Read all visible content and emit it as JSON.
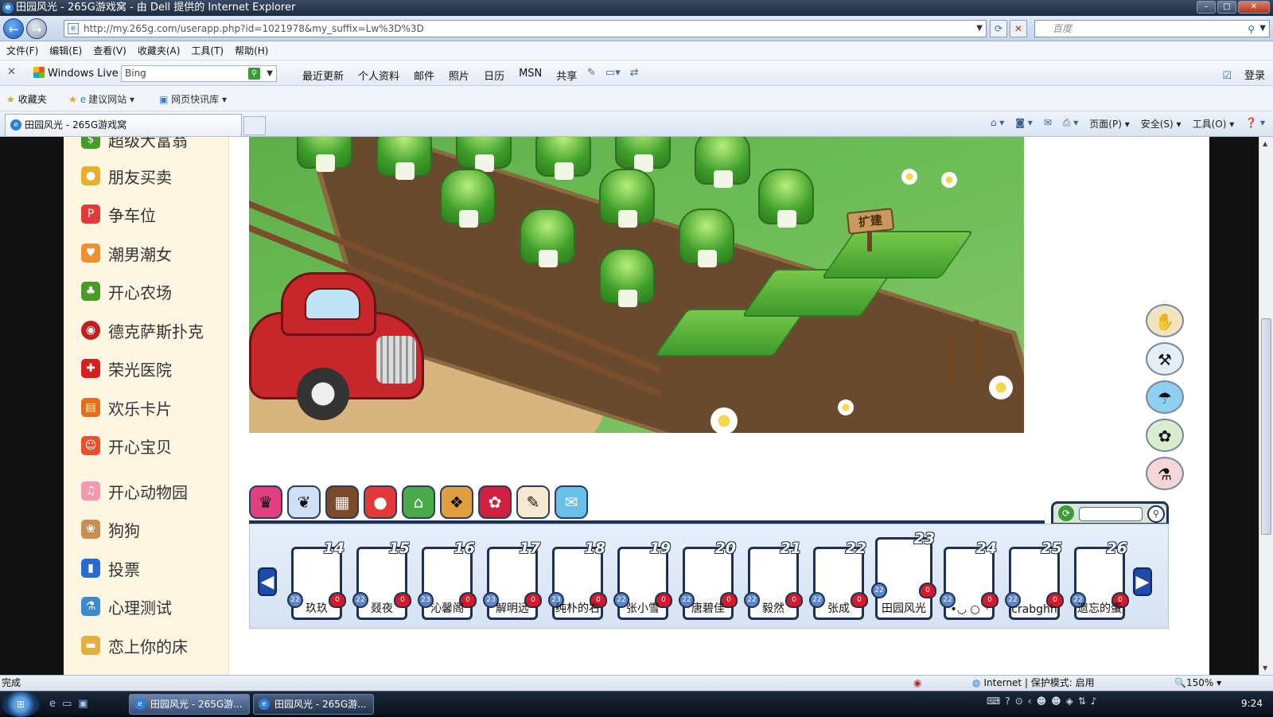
{
  "window": {
    "title": "田园风光 - 265G游戏窝 - 由 Dell 提供的 Internet Explorer"
  },
  "address": {
    "url": "http://my.265g.com/userapp.php?id=1021978&my_suffix=Lw%3D%3D"
  },
  "search": {
    "placeholder": "百度"
  },
  "menu": [
    "文件(F)",
    "编辑(E)",
    "查看(V)",
    "收藏夹(A)",
    "工具(T)",
    "帮助(H)"
  ],
  "live": {
    "brand": "Windows Live",
    "search_value": "Bing",
    "links": [
      "最近更新",
      "个人资料",
      "邮件",
      "照片",
      "日历",
      "MSN",
      "共享"
    ],
    "login": "登录"
  },
  "favorites": {
    "label": "收藏夹",
    "suggested": "建议网站",
    "webslice": "网页快讯库"
  },
  "tab": {
    "title": "田园风光 - 265G游戏窝"
  },
  "commands": {
    "page": "页面(P)",
    "safety": "安全(S)",
    "tools": "工具(O)"
  },
  "sidebar": {
    "top_partial": "超级大富翁",
    "items": [
      {
        "label": "朋友买卖",
        "icon": "coins-icon",
        "color": "#e8b02a"
      },
      {
        "label": "争车位",
        "icon": "parking-icon",
        "color": "#e03a3a"
      },
      {
        "label": "潮男潮女",
        "icon": "couple-icon",
        "color": "#f09030"
      },
      {
        "label": "开心农场",
        "icon": "sprout-icon",
        "color": "#4a9a2a"
      },
      {
        "label": "德克萨斯扑克",
        "icon": "poker-chip-icon",
        "color": "#c02020"
      },
      {
        "label": "荣光医院",
        "icon": "hospital-cross-icon",
        "color": "#d62020"
      },
      {
        "label": "欢乐卡片",
        "icon": "card-icon",
        "color": "#e07020"
      },
      {
        "label": "开心宝贝",
        "icon": "baby-icon",
        "color": "#e85030"
      },
      {
        "label": "开心动物园",
        "icon": "pig-icon",
        "color": "#f09ab0"
      },
      {
        "label": "狗狗",
        "icon": "dog-icon",
        "color": "#c89050"
      },
      {
        "label": "投票",
        "icon": "bar-chart-icon",
        "color": "#2a6ad0"
      },
      {
        "label": "心理测试",
        "icon": "flask-icon",
        "color": "#3a8ad0"
      },
      {
        "label": "恋上你的床",
        "icon": "bed-icon",
        "color": "#e0b040"
      }
    ]
  },
  "farm": {
    "sign_text": "扩建"
  },
  "tools": [
    "hand-icon",
    "shovel-icon",
    "watering-can-icon",
    "fertilizer-icon",
    "pesticide-icon"
  ],
  "gamebar_icons": [
    {
      "name": "crown-icon",
      "color": "#e04080"
    },
    {
      "name": "seed-bag-icon",
      "color": "#cfe0f5"
    },
    {
      "name": "chocolate-icon",
      "color": "#7a4a2a"
    },
    {
      "name": "mushroom-icon",
      "color": "#e03a3a"
    },
    {
      "name": "shop-icon",
      "color": "#4aaa4a"
    },
    {
      "name": "dog-face-icon",
      "color": "#e0a040"
    },
    {
      "name": "rose-icon",
      "color": "#d02040"
    },
    {
      "name": "note-icon",
      "color": "#f5ead0"
    },
    {
      "name": "mail-icon",
      "color": "#6ac0e8"
    }
  ],
  "friends": [
    {
      "level": "14",
      "name": "玖玖",
      "badge": "22"
    },
    {
      "level": "15",
      "name": "叕夜",
      "badge": "22"
    },
    {
      "level": "16",
      "name": "沁馨阁",
      "badge": "23"
    },
    {
      "level": "17",
      "name": "解明远",
      "badge": "23"
    },
    {
      "level": "18",
      "name": "纯朴的右",
      "badge": "23"
    },
    {
      "level": "19",
      "name": "张小雪",
      "badge": "22"
    },
    {
      "level": "20",
      "name": "唐碧佳",
      "badge": "22"
    },
    {
      "level": "21",
      "name": "毅然",
      "badge": "22"
    },
    {
      "level": "22",
      "name": "张成",
      "badge": "22"
    },
    {
      "level": "23",
      "name": "田园风光",
      "badge": "22",
      "selected": true
    },
    {
      "level": "24",
      "name": "•◡ ○ ◝",
      "badge": "22"
    },
    {
      "level": "25",
      "name": "crabghh",
      "badge": "22"
    },
    {
      "level": "26",
      "name": "遗忘的蛋",
      "badge": "22"
    }
  ],
  "heart_value": "0",
  "status": {
    "text": "完成",
    "zone": "Internet | 保护模式: 启用",
    "zoom": "150%"
  },
  "taskbar": {
    "tasks": [
      "田园风光 - 265G游...",
      "田园风光 - 265G游..."
    ],
    "clock": "9:24"
  }
}
